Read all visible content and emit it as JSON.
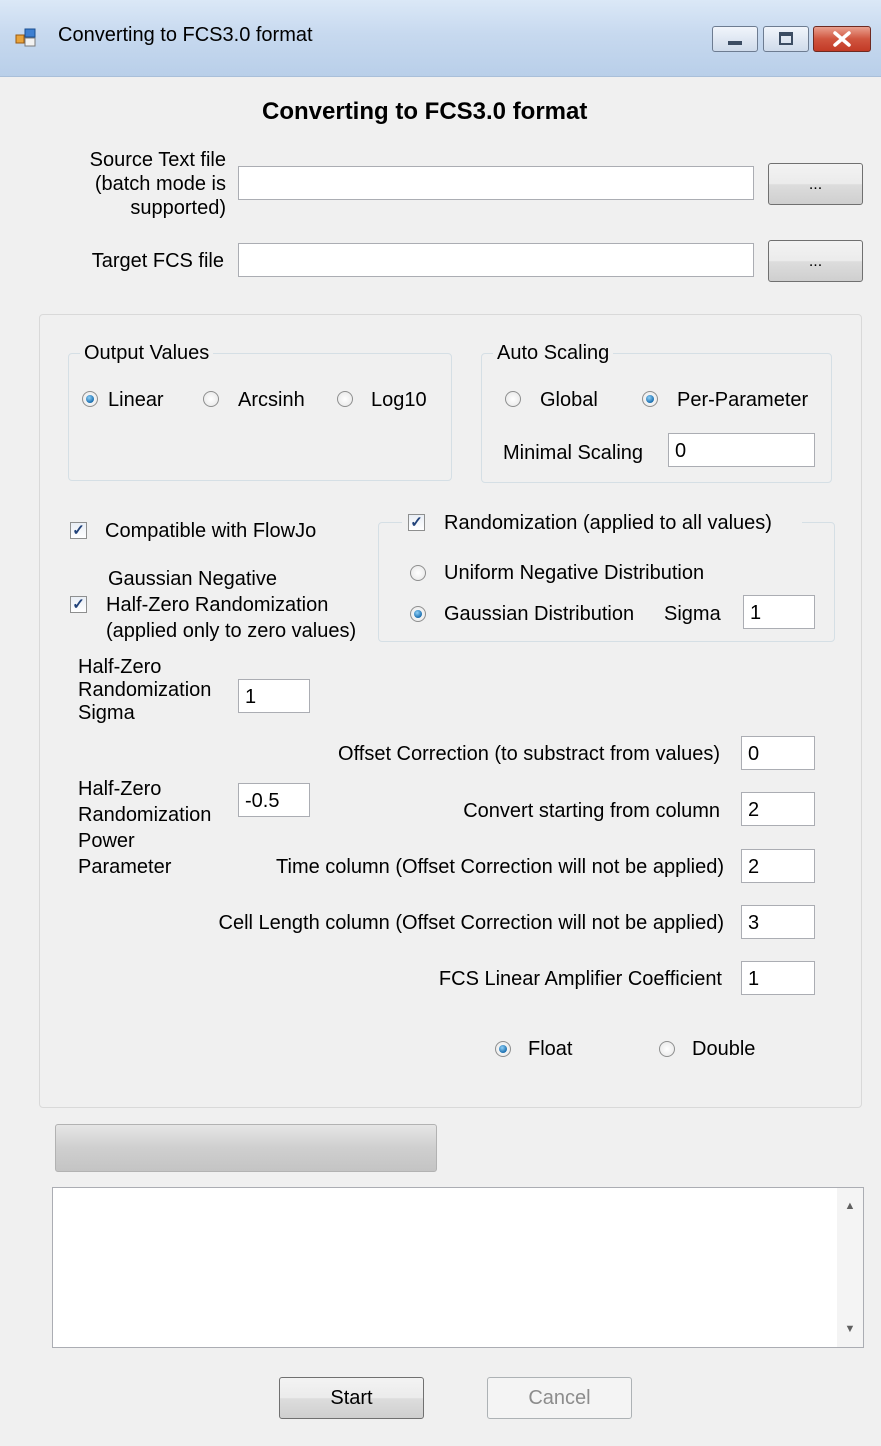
{
  "window": {
    "title": "Converting to FCS3.0 format"
  },
  "header": {
    "title": "Converting to FCS3.0 format"
  },
  "source": {
    "label_lines": [
      "Source Text file",
      "(batch mode is",
      "supported)"
    ],
    "value": "",
    "browse_label": "..."
  },
  "target": {
    "label": "Target FCS file",
    "value": "",
    "browse_label": "..."
  },
  "output_values": {
    "title": "Output Values",
    "options": [
      {
        "label": "Linear",
        "selected": true
      },
      {
        "label": "Arcsinh",
        "selected": false
      },
      {
        "label": "Log10",
        "selected": false
      }
    ]
  },
  "auto_scaling": {
    "title": "Auto Scaling",
    "options": [
      {
        "label": "Global",
        "selected": false
      },
      {
        "label": "Per-Parameter",
        "selected": true
      }
    ],
    "minimal_label": "Minimal Scaling",
    "minimal_value": "0"
  },
  "flowjo": {
    "label": "Compatible with FlowJo",
    "checked": true
  },
  "gaussian_half_zero": {
    "label_lines": [
      "Gaussian  Negative",
      "Half-Zero Randomization",
      "(applied only to zero values)"
    ],
    "checked": true
  },
  "randomization": {
    "title": "Randomization (applied to all values)",
    "checked": true,
    "uniform_label": "Uniform Negative Distribution",
    "uniform_selected": false,
    "gaussian_label": "Gaussian Distribution",
    "gaussian_selected": true,
    "sigma_label": "Sigma",
    "sigma_value": "1"
  },
  "half_zero_sigma": {
    "label_lines": [
      "Half-Zero",
      "Randomization",
      "Sigma"
    ],
    "value": "1"
  },
  "half_zero_power": {
    "label_lines": [
      "Half-Zero",
      "Randomization",
      "Power",
      "Parameter"
    ],
    "value": "-0.5"
  },
  "offset_correction": {
    "label": "Offset Correction (to substract from values)",
    "value": "0"
  },
  "start_column": {
    "label": "Convert starting from column",
    "value": "2"
  },
  "time_column": {
    "label": "Time column (Offset Correction will not be applied)",
    "value": "2"
  },
  "cell_length_column": {
    "label": "Cell Length column (Offset Correction will not be applied)",
    "value": "3"
  },
  "amplifier": {
    "label": "FCS Linear Amplifier Coefficient",
    "value": "1"
  },
  "precision": {
    "options": [
      {
        "label": "Float",
        "selected": true
      },
      {
        "label": "Double",
        "selected": false
      }
    ]
  },
  "progress": {
    "value": 0
  },
  "log": {
    "text": ""
  },
  "actions": {
    "start_label": "Start",
    "cancel_label": "Cancel",
    "cancel_enabled": false
  },
  "icons": {
    "scroll_up": "scroll-up-arrow-icon",
    "scroll_down": "scroll-down-arrow-icon"
  }
}
